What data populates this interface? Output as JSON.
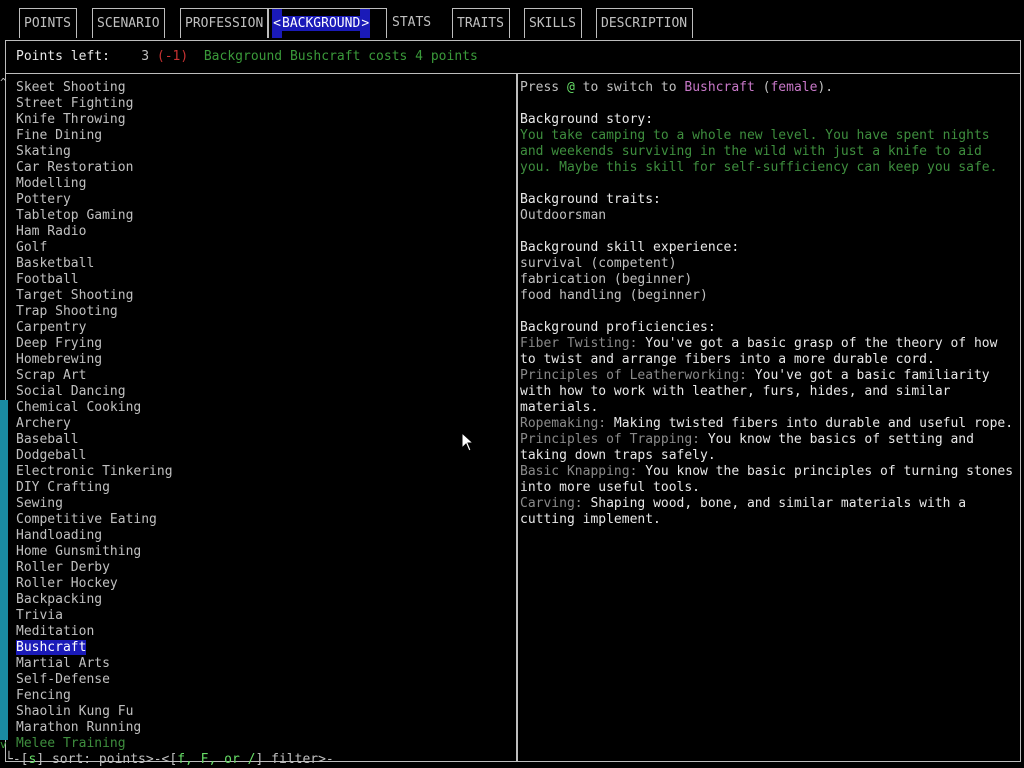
{
  "tabs": [
    {
      "label": "POINTS"
    },
    {
      "label": "SCENARIO"
    },
    {
      "label": "PROFESSION"
    },
    {
      "label": "BACKGROUND",
      "prev_arrow": "<",
      "next_arrow": ">"
    },
    {
      "label": "STATS"
    },
    {
      "label": "TRAITS"
    },
    {
      "label": "SKILLS"
    },
    {
      "label": "DESCRIPTION"
    }
  ],
  "header": {
    "points_label": "Points left:",
    "points_value": "3",
    "points_delta": "(-1)",
    "cost_message": "Background Bushcraft costs 4 points"
  },
  "list": {
    "scroll_up": "^",
    "scroll_down": "v",
    "items": [
      "Skeet Shooting",
      "Street Fighting",
      "Knife Throwing",
      "Fine Dining",
      "Skating",
      "Car Restoration",
      "Modelling",
      "Pottery",
      "Tabletop Gaming",
      "Ham Radio",
      "Golf",
      "Basketball",
      "Football",
      "Target Shooting",
      "Trap Shooting",
      "Carpentry",
      "Deep Frying",
      "Homebrewing",
      "Scrap Art",
      "Social Dancing",
      "Chemical Cooking",
      "Archery",
      "Baseball",
      "Dodgeball",
      "Electronic Tinkering",
      "DIY Crafting",
      "Sewing",
      "Competitive Eating",
      "Handloading",
      "Home Gunsmithing",
      "Roller Derby",
      "Roller Hockey",
      "Backpacking",
      "Trivia",
      "Meditation",
      "Bushcraft",
      "Martial Arts",
      "Self-Defense",
      "Fencing",
      "Shaolin Kung Fu",
      "Marathon Running",
      "Melee Training"
    ],
    "selected": "Bushcraft"
  },
  "detail": {
    "switch_pre": "Press ",
    "switch_key": "@",
    "switch_mid": " to switch to ",
    "switch_name": "Bushcraft",
    "switch_gender_open": " (",
    "switch_gender": "female",
    "switch_gender_close": ").",
    "story_heading": "Background story:",
    "story_text": "You take camping to a whole new level.  You have spent nights and weekends surviving in the wild with just a knife to aid you.  Maybe this skill for self-sufficiency can keep you safe.",
    "traits_heading": "Background traits:",
    "traits": [
      "Outdoorsman"
    ],
    "skills_heading": "Background skill experience:",
    "skills": [
      "survival (competent)",
      "fabrication (beginner)",
      "food handling (beginner)"
    ],
    "prof_heading": "Background proficiencies:",
    "proficiencies": [
      {
        "name": "Fiber Twisting:",
        "desc": " You've got a basic grasp of the theory of how to twist and arrange fibers into a more durable cord."
      },
      {
        "name": "Principles of Leatherworking:",
        "desc": " You've got a basic familiarity with how to work with leather, furs, hides, and similar materials."
      },
      {
        "name": "Ropemaking:",
        "desc": " Making twisted fibers into durable and useful rope."
      },
      {
        "name": "Principles of Trapping:",
        "desc": " You know the basics of setting and taking down traps safely."
      },
      {
        "name": "Basic Knapping:",
        "desc": " You know the basic principles of turning stones into more useful tools."
      },
      {
        "name": "Carving:",
        "desc": " Shaping wood, bone, and similar materials with a cutting implement."
      }
    ]
  },
  "footer": {
    "prefix": "└-[",
    "sort_key": "s",
    "sort_text": "] sort: points>-<[",
    "filter_keys": "f, F, or /",
    "filter_text": "] filter>-"
  }
}
